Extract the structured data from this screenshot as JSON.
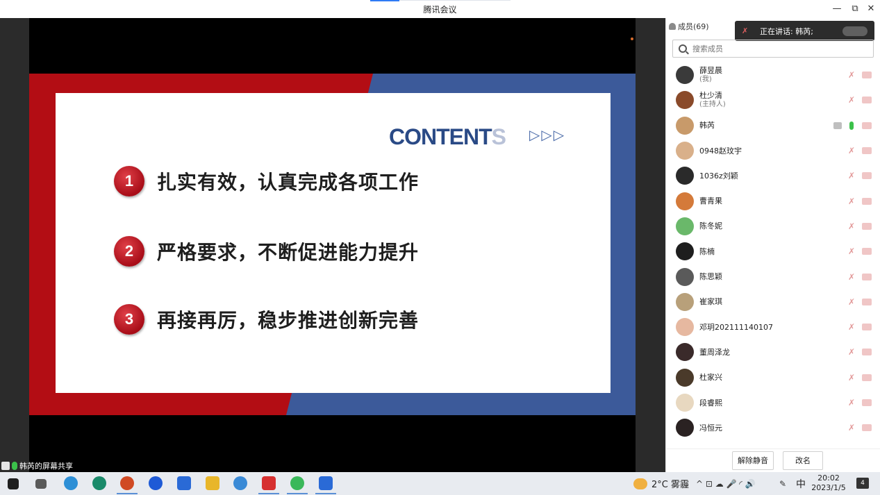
{
  "window": {
    "title": "腾讯会议",
    "minimize_glyph": "—",
    "restore_glyph": "⧉",
    "close_glyph": "✕"
  },
  "slide": {
    "heading_main": "CONTENT",
    "heading_fade": "S",
    "heading_arrows": "▷▷▷",
    "items": [
      {
        "number": "1",
        "text": "扎实有效，认真完成各项工作"
      },
      {
        "number": "2",
        "text": "严格要求，不断促进能力提升"
      },
      {
        "number": "3",
        "text": "再接再厉，稳步推进创新完善"
      }
    ],
    "colors": {
      "red": "#b30d14",
      "blue": "#3c5a9a",
      "heading": "#2a4a86"
    }
  },
  "share_bar": {
    "label": "韩芮的屏幕共享"
  },
  "panel": {
    "header": "成员(69)",
    "speaking": "正在讲话: 韩芮;",
    "search_placeholder": "搜索成员",
    "members": [
      {
        "name": "薛昱晨",
        "sub": "(我)",
        "avatar_color": "#3a3a3a",
        "speaking": false
      },
      {
        "name": "杜少清",
        "sub": "(主持人)",
        "avatar_color": "#8a4a2a",
        "speaking": false
      },
      {
        "name": "韩芮",
        "sub": "",
        "avatar_color": "#c89a6a",
        "speaking": true
      },
      {
        "name": "0948赵玟宇",
        "sub": "",
        "avatar_color": "#d9b08a",
        "speaking": false
      },
      {
        "name": "1036z刘颖",
        "sub": "",
        "avatar_color": "#2a2a2a",
        "speaking": false
      },
      {
        "name": "曹青果",
        "sub": "",
        "avatar_color": "#d47a3a",
        "speaking": false
      },
      {
        "name": "陈冬妮",
        "sub": "",
        "avatar_color": "#6ab86a",
        "speaking": false
      },
      {
        "name": "陈楠",
        "sub": "",
        "avatar_color": "#1e1e1e",
        "speaking": false
      },
      {
        "name": "陈思颖",
        "sub": "",
        "avatar_color": "#5a5a5a",
        "speaking": false
      },
      {
        "name": "崔家琪",
        "sub": "",
        "avatar_color": "#b8a07a",
        "speaking": false
      },
      {
        "name": "邓玥202111140107",
        "sub": "",
        "avatar_color": "#e6b8a0",
        "speaking": false
      },
      {
        "name": "董周泽龙",
        "sub": "",
        "avatar_color": "#3a2a2a",
        "speaking": false
      },
      {
        "name": "杜家兴",
        "sub": "",
        "avatar_color": "#4a3a2a",
        "speaking": false
      },
      {
        "name": "段睿熙",
        "sub": "",
        "avatar_color": "#e8d8c0",
        "speaking": false
      },
      {
        "name": "冯恒元",
        "sub": "",
        "avatar_color": "#2a2222",
        "speaking": false
      }
    ],
    "unmute_button": "解除静音",
    "rename_button": "改名"
  },
  "taskbar": {
    "weather": "2°C 雾霾",
    "ime": "中",
    "time": "20:02",
    "date": "2023/1/5",
    "notification_count": "4",
    "tray_icons": "^ ⊡ ☁ 🎤 ◜ 🔊"
  }
}
